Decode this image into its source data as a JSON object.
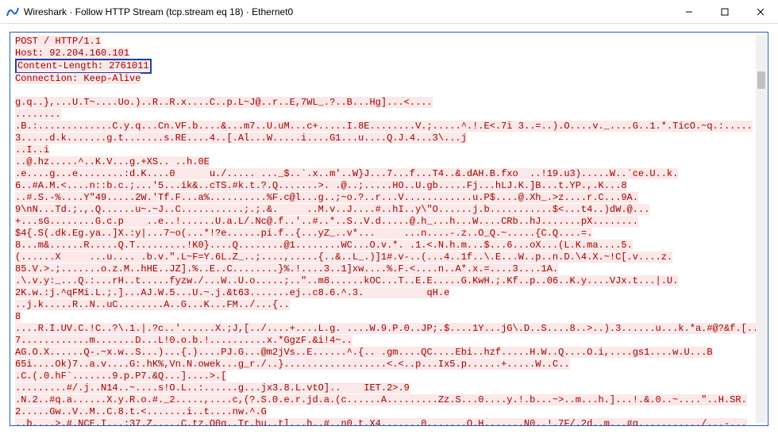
{
  "titlebar": {
    "app_name": "Wireshark",
    "title": "Wireshark · Follow HTTP Stream (tcp.stream eq 18) · Ethernet0"
  },
  "win_controls": {
    "minimize": "—",
    "maximize": "☐",
    "close": "✕"
  },
  "http": {
    "request_line": "POST / HTTP/1.1",
    "host_header": "Host: 92.204.160.101",
    "content_length_header": "Content-Length: 2761011",
    "connection_header": "Connection: Keep-Alive"
  },
  "body_lines": [
    "g.q..},...U.T~....Uo.)..R..R.x....C..p.L~J@..r..E,7WL_.?..B...Hg]...<....",
    "........",
    ".B.:.............C.y.q...Cn.VF.b....&...m7..U.uM...c+.....I.8E........V.;.....^.!.E<.7i 3..=..).O....v._....G..1.*.TicO.~q.:.....",
    "3.....d.k.......g.t.......s.RE....4..[.Al...W.....i....G1...u....Q.J.4...3\\...j",
    "..I..i",
    "..@.hz.....^..K.V...g.+XS.. ..h.0E",
    ".e....g...e........:d.K....0      u./..... ..._$..`.x..m'..W}J...7...f...T4..&.dAH.B.fxo  ..!19.u3).....W..`ce.U..k.",
    "6..#A.M.<....n::b.c.;...'5...ik&..cTS.#k.t.?.Q.......>. .@..;.....HO..U.gb.....Fj...hLJ.K.]B...t.YP.,.K...8",
    "..#.S.-%....Y\"49.....2W.'Tf.F...a%..........%F.c@l...g..;~o.?..r...V............u.P$....@.Xh_.>z....r.C...9A.",
    "9\\nN...Td.;.,.Q......u~.~J..C...........;.;.&.     ..M.v..J....#..hI..y\\\"O......j.b...........$<...t4..)dW.@...",
    "+...sG........G.c.p    ..e..!......U.a.L/.Nc@.f..'..#..*..S..V.d.....@.h_...h...W....CRb..hJ.......pX........",
    "$4{.S(.dk.Eg.ya..]X.:y|...7~o(...*!?e......pi.f..{...yZ_..v*...     ...n....-.z..O_Q.~.....{C.Q....=.",
    "8...m&......R.....Q.T.........!K0}....Q........@1........WC...O.v.*. .1.<.N.h.m...$...6...oX...(L.K.ma....5.",
    "(......X     ...u.... .b.v.\".L~F=Y.6L.Z_..;....,.....{..&..L_.)]1#.v-..(...4..1f..\\.E...W..p..n.D.\\4.X.~!C[.v....z.",
    "85.V.>.;.......o.z.M..hHE..JZ].%..E..C........}%.!....3..1]xw....%.F.<....n..A*.x.=....3....1A.",
    ".\\.v.y:_...Q.:...rH..t.....fyzw./...W..U.o.....;..\"..m8......kOC...T..E.E.....G.KwH.;.Kf..p..06..K.y....VJx.t...|.U.",
    "2K.w.:j.^qFMi.L.;.]...AJ.W.5...U.~.j.&t63.......ej..c8.6.^.3.           qH.e",
    "..j.k.....R..N..uC........A..G...K...FM../...{..",
    "8",
    "....R.I.UV.C.!C..?\\.1.|.?c..'......X.;J,[../....+....L.g. ....W.9.P.0..JP;.$....1Y...jG\\.D..S....8..>..).3......u...k.*a.#@?&f.[..",
    "7............m.......D...L!0.o.b.!..........x.*GgzF.&i!4~..",
    "AG.O.X......Q-.~x.w..S...)...{.)....PJ.G...@m2jVs..E......^.{.. .gm....QC....Ebi..hzf.....H.W..Q....O.i,....gs1....w.U...B",
    "65i....Ok)7..a.v....G:.hK%,Vn.N.owek...g_r./..}..................<.<..p...Ix5.p......+.....W..C..",
    ".C.(.0.hF`.......9.p.P7.&Q...]....>.[",
    ".........#/.j..N14..~....s!O.L..:......g...jx3.8.L.vtO]..    IET.2>.9",
    ".N.2..#q.a......X.y.R.o.#._2.....,....c,(?.S.0.e.r.jd.a.(c......A.........Zz.S...0....y.!.b...~>..m...h.]...!.&.0..~....\"..H.SR.",
    "2.....Gw..V..M..C.8.t.<.......i..t....nw.^.G",
    "..b....>.#.NCE.I...;37.Z.....C.tz.O0g..Tr.hu..tl...h..#..n0.t.X4.......0.......Q.H.......N0..!.7F/.2d..m...#q.........../...-..."
  ]
}
